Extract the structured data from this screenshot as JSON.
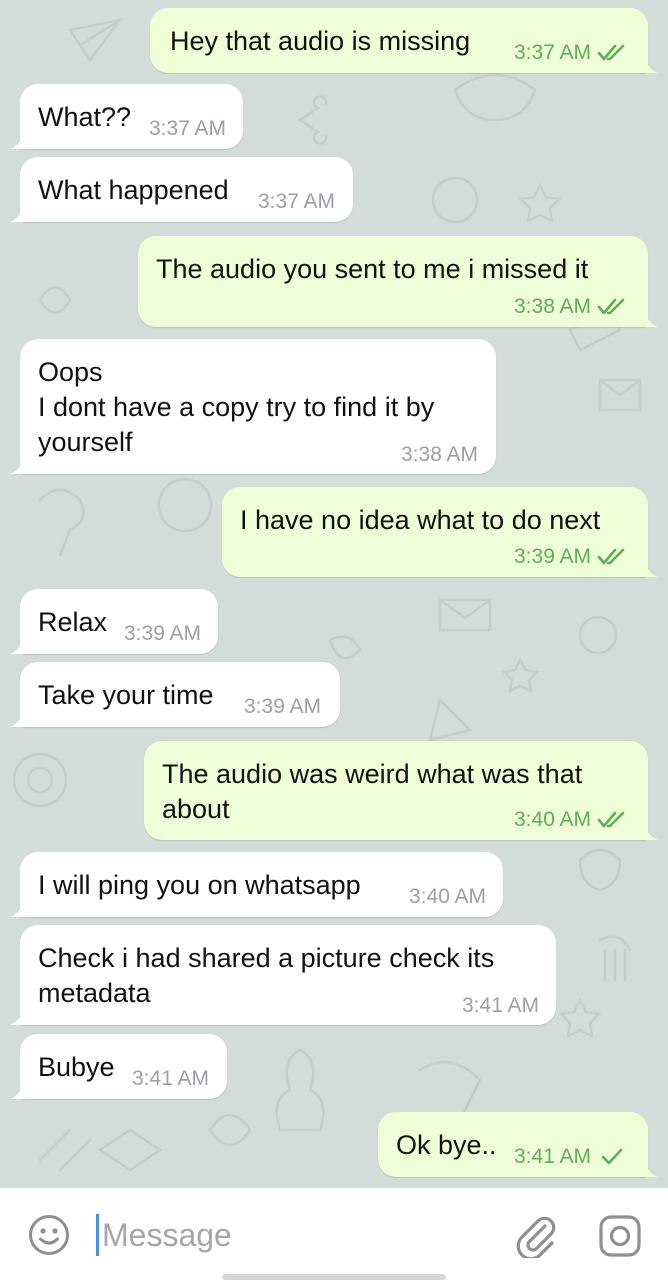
{
  "messages": [
    {
      "id": 1,
      "dir": "out",
      "text": [
        "Hey that audio is missing"
      ],
      "time": "3:37 AM",
      "status": "read"
    },
    {
      "id": 2,
      "dir": "in",
      "text": [
        "What??"
      ],
      "time": "3:37 AM"
    },
    {
      "id": 3,
      "dir": "in",
      "text": [
        "What happened"
      ],
      "time": "3:37 AM"
    },
    {
      "id": 4,
      "dir": "out",
      "text": [
        "The audio you sent to me i missed it"
      ],
      "time": "3:38 AM",
      "status": "read"
    },
    {
      "id": 5,
      "dir": "in",
      "text": [
        "Oops",
        "I dont have a copy try to find it by",
        "yourself"
      ],
      "time": "3:38 AM"
    },
    {
      "id": 6,
      "dir": "out",
      "text": [
        "I have no idea what to do next"
      ],
      "time": "3:39 AM",
      "status": "read"
    },
    {
      "id": 7,
      "dir": "in",
      "text": [
        "Relax"
      ],
      "time": "3:39 AM"
    },
    {
      "id": 8,
      "dir": "in",
      "text": [
        "Take your time"
      ],
      "time": "3:39 AM"
    },
    {
      "id": 9,
      "dir": "out",
      "text": [
        "The audio was weird what was that",
        "about"
      ],
      "time": "3:40 AM",
      "status": "read"
    },
    {
      "id": 10,
      "dir": "in",
      "text": [
        "I will ping you on whatsapp"
      ],
      "time": "3:40 AM"
    },
    {
      "id": 11,
      "dir": "in",
      "text": [
        "Check i had shared a picture check its",
        "metadata"
      ],
      "time": "3:41 AM"
    },
    {
      "id": 12,
      "dir": "in",
      "text": [
        "Bubye"
      ],
      "time": "3:41 AM"
    },
    {
      "id": 13,
      "dir": "out",
      "text": [
        "Ok bye.."
      ],
      "time": "3:41 AM",
      "status": "sent"
    }
  ],
  "composer": {
    "placeholder": "Message",
    "emoji_icon": "smiley-icon",
    "attach_icon": "paperclip-icon",
    "camera_icon": "camera-icon"
  },
  "colors": {
    "chat_background": "#d3dcd9",
    "incoming_bubble": "#ffffff",
    "outgoing_bubble": "#eefed7",
    "outgoing_meta": "#5fae55",
    "incoming_meta": "#9aa0a6",
    "cursor": "#4a90e2"
  }
}
